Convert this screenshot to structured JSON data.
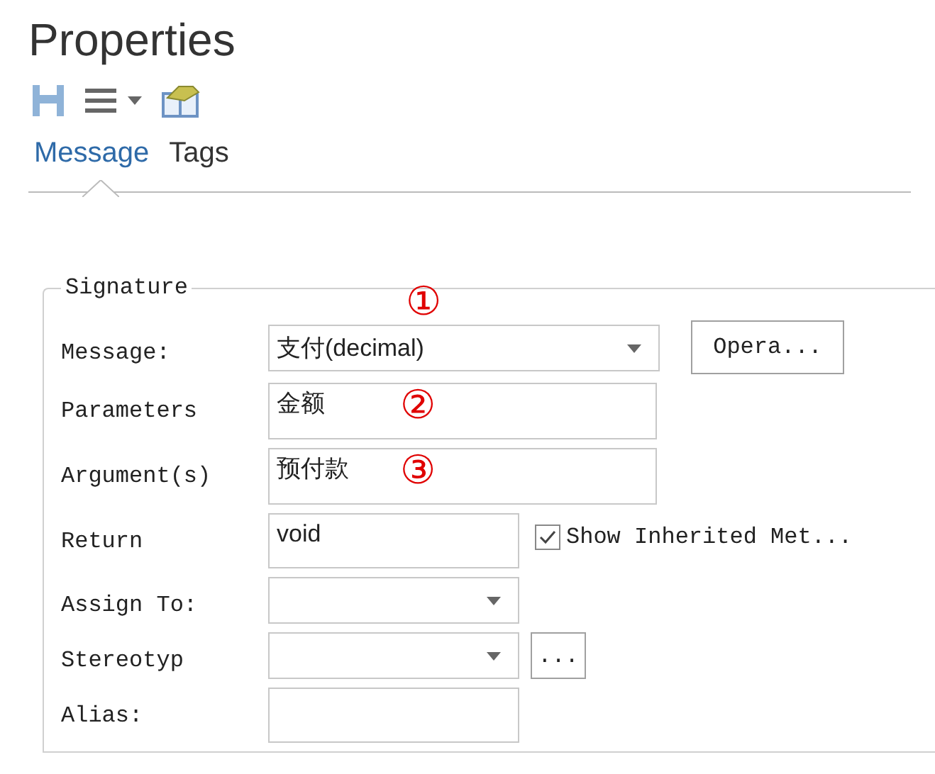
{
  "window": {
    "title": "Properties"
  },
  "tabs": [
    {
      "label": "Message",
      "selected": true
    },
    {
      "label": "Tags",
      "selected": false
    }
  ],
  "group": {
    "title": "Signature",
    "rows": [
      {
        "kind": "combo",
        "label": "Message:",
        "value": "支付(decimal)",
        "annotation": "①",
        "button": "Opera..."
      },
      {
        "kind": "area",
        "label": "Parameters",
        "value": "金额",
        "annotation": "②"
      },
      {
        "kind": "area",
        "label": "Argument(s)",
        "value": "预付款",
        "annotation": "③"
      },
      {
        "kind": "text",
        "label": "Return",
        "value": "void",
        "checkbox": {
          "label": "Show Inherited Met...",
          "checked": true
        }
      },
      {
        "kind": "combo",
        "label": "Assign To:"
      },
      {
        "kind": "combo",
        "label": "Stereotyp",
        "button": "..."
      },
      {
        "kind": "text",
        "label": "Alias:"
      }
    ]
  }
}
